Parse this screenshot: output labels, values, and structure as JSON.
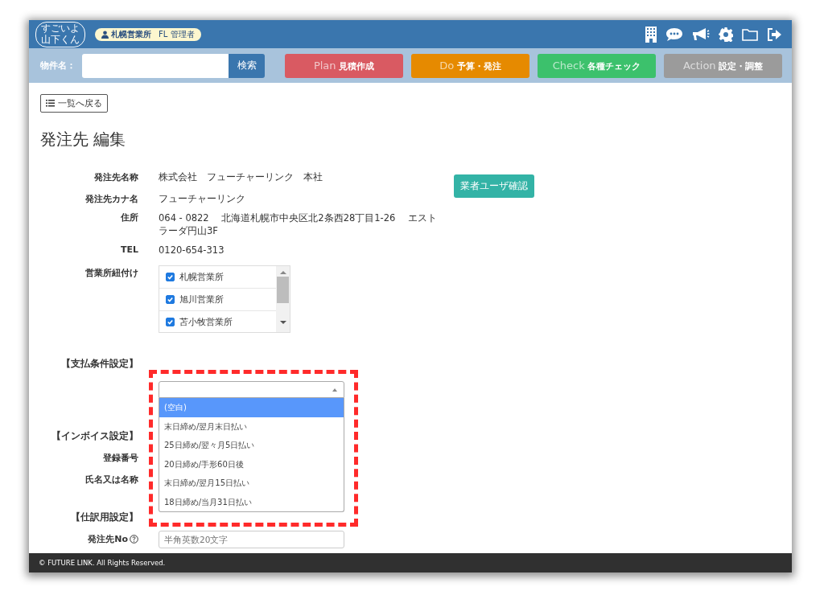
{
  "header": {
    "logo": {
      "top": "すごいよ",
      "bottom": "山下くん"
    },
    "user_badge": {
      "office": "札幌営業所",
      "role": "FL 管理者"
    }
  },
  "toolbar": {
    "search_label": "物件名：",
    "search_button": "検索",
    "phases": [
      {
        "en": "Plan",
        "ja": "見積作成",
        "color": "#d95a62"
      },
      {
        "en": "Do",
        "ja": "予算・発注",
        "color": "#e68a00"
      },
      {
        "en": "Check",
        "ja": "各種チェック",
        "color": "#3cc16c"
      },
      {
        "en": "Action",
        "ja": "設定・調整",
        "color": "#9b9b9b"
      }
    ]
  },
  "back_button": "一覧へ戻る",
  "title": "発注先 編集",
  "vendor_user_button": "業者ユーザ確認",
  "rows": [
    {
      "kind": "text",
      "label": "発注先名称",
      "value": "株式会社　フューチャーリンク　本社"
    },
    {
      "kind": "text",
      "label": "発注先カナ名",
      "value": "フューチャーリンク"
    },
    {
      "kind": "text",
      "label": "住所",
      "value": "064 - 0822　 北海道札幌市中央区北2条西28丁目1-26　 エストラーダ円山3F"
    },
    {
      "kind": "text",
      "label": "TEL",
      "value": "0120-654-313"
    },
    {
      "kind": "checklist",
      "label": "営業所紐付け",
      "items": [
        {
          "name": "札幌営業所",
          "checked": true
        },
        {
          "name": "旭川営業所",
          "checked": true
        },
        {
          "name": "苫小牧営業所",
          "checked": true
        }
      ]
    },
    {
      "kind": "select",
      "label": "【支払条件設定】",
      "options": [
        {
          "text": "(空白)",
          "selected": true
        },
        {
          "text": "末日締め/翌月末日払い",
          "selected": false
        },
        {
          "text": "25日締め/翌々月5日払い",
          "selected": false
        },
        {
          "text": "20日締め/手形60日後",
          "selected": false
        },
        {
          "text": "末日締め/翌月15日払い",
          "selected": false
        },
        {
          "text": "18日締め/当月31日払い",
          "selected": false
        }
      ]
    },
    {
      "kind": "section",
      "label": "【インボイス設定】"
    },
    {
      "kind": "field",
      "label": "登録番号"
    },
    {
      "kind": "field",
      "label": "氏名又は名称"
    },
    {
      "kind": "section",
      "label": "【仕訳用設定】"
    },
    {
      "kind": "input",
      "label": "発注先No",
      "placeholder": "半角英数20文字"
    }
  ],
  "footer": "© FUTURE LINK. All Rights Reserved."
}
